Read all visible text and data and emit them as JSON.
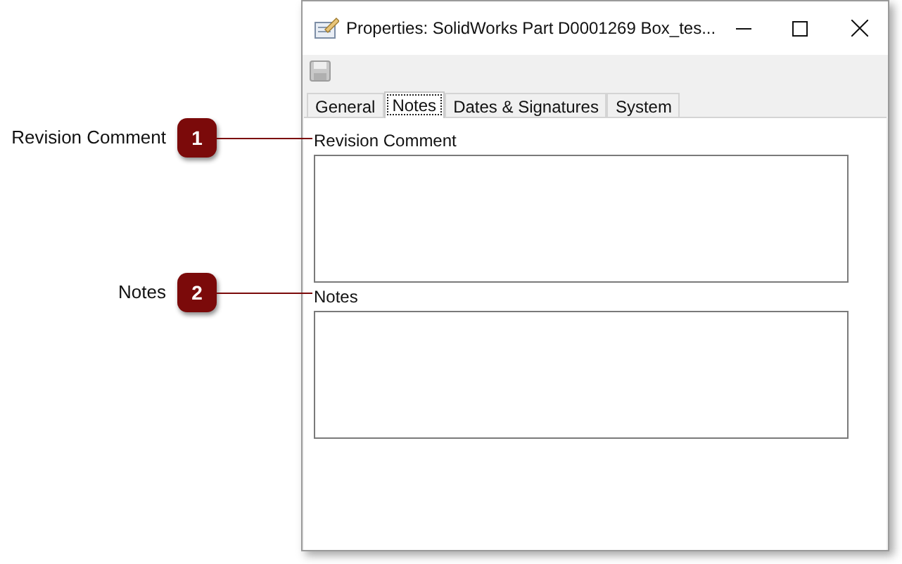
{
  "window": {
    "title": "Properties: SolidWorks Part D0001269 Box_tes..."
  },
  "tabs": [
    {
      "label": "General",
      "selected": false
    },
    {
      "label": "Notes",
      "selected": true
    },
    {
      "label": "Dates & Signatures",
      "selected": false
    },
    {
      "label": "System",
      "selected": false
    }
  ],
  "fields": [
    {
      "label": "Revision Comment"
    },
    {
      "label": "Notes"
    }
  ],
  "callouts": [
    {
      "number": "1",
      "label": "Revision Comment"
    },
    {
      "number": "2",
      "label": "Notes"
    }
  ]
}
